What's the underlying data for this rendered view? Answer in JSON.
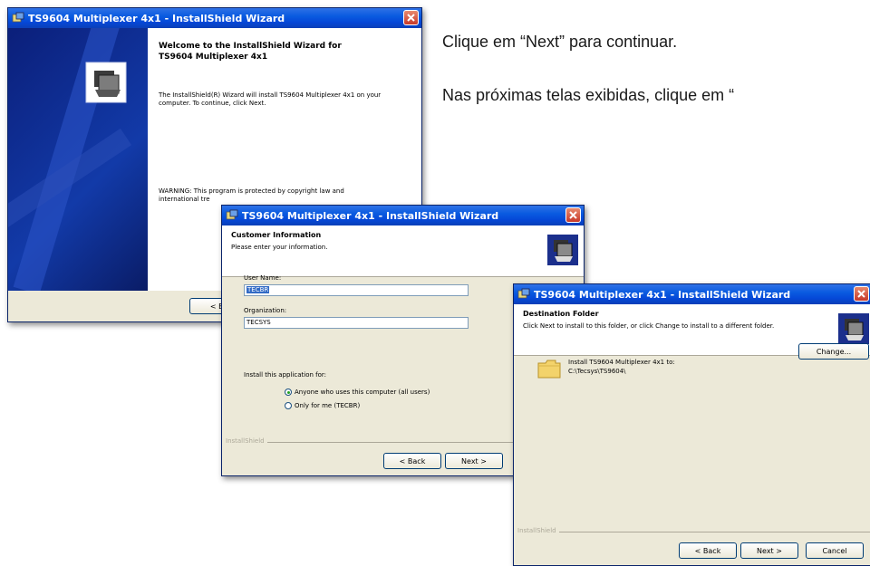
{
  "doc": {
    "line1": "Clique em “Next” para continuar.",
    "line2": "Nas próximas telas exibidas, clique em “"
  },
  "window1": {
    "title": "TS9604 Multiplexer 4x1 - InstallShield Wizard",
    "heading_line1": "Welcome to the InstallShield Wizard for",
    "heading_line2": "TS9604 Multiplexer 4x1",
    "body": "The InstallShield(R) Wizard will install TS9604 Multiplexer 4x1 on your computer. To continue, click Next.",
    "warning_line1": "WARNING: This program is protected by copyright law and",
    "warning_line2": "international tre",
    "back_partial": "< E"
  },
  "window2": {
    "title": "TS9604 Multiplexer 4x1 - InstallShield Wizard",
    "header_title": "Customer Information",
    "header_subtitle": "Please enter your information.",
    "user_name_label": "User Name:",
    "user_name_value": "TECBR",
    "organization_label": "Organization:",
    "organization_value": "TECSYS",
    "install_for_label": "Install this application for:",
    "option_all": "Anyone who uses this computer (all users)",
    "option_me": "Only for me (TECBR)",
    "brand": "InstallShield",
    "back_label": "< Back",
    "next_label": "Next >"
  },
  "window3": {
    "title": "TS9604 Multiplexer 4x1 - InstallShield Wizard",
    "header_title": "Destination Folder",
    "header_subtitle": "Click Next to install to this folder, or click Change to install to a different folder.",
    "install_to": "Install TS9604 Multiplexer 4x1 to:",
    "path": "C:\\Tecsys\\TS9604\\",
    "change_label": "Change...",
    "brand": "InstallShield",
    "back_label": "< Back",
    "next_label": "Next >",
    "cancel_label": "Cancel"
  }
}
